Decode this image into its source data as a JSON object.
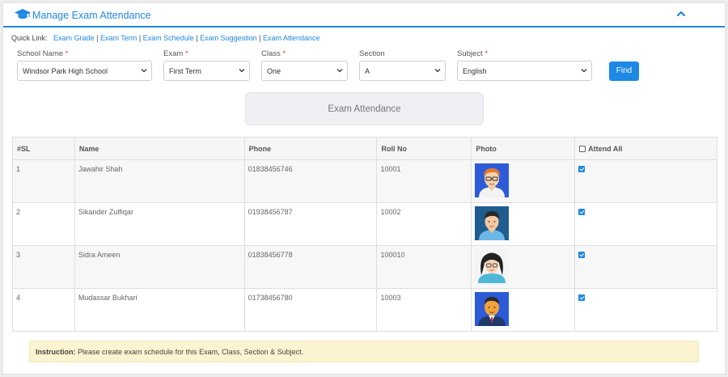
{
  "header": {
    "title": "Manage Exam Attendance"
  },
  "quick_links": {
    "label": "Quick Link:",
    "items": [
      "Exam Grade",
      "Exam Term",
      "Exam Schedule",
      "Exam Suggestion",
      "Exam Attendance"
    ],
    "separator": "|"
  },
  "filters": {
    "school": {
      "label": "School Name",
      "value": "Windsor Park High School",
      "required": "*"
    },
    "exam": {
      "label": "Exam",
      "value": "First Term",
      "required": "*"
    },
    "class": {
      "label": "Class",
      "value": "One",
      "required": "*"
    },
    "section": {
      "label": "Section",
      "value": "A"
    },
    "subject": {
      "label": "Subject",
      "value": "English",
      "required": "*"
    },
    "find_label": "Find"
  },
  "exam_attendance_label": "Exam Attendance",
  "table": {
    "headers": {
      "sl": "#SL",
      "name": "Name",
      "phone": "Phone",
      "roll": "Roll No",
      "photo": "Photo",
      "attend": "Attend All"
    },
    "rows": [
      {
        "sl": "1",
        "name": "Jawahir Shah",
        "phone": "01838456746",
        "roll": "10001"
      },
      {
        "sl": "2",
        "name": "Sikander Zulfiqar",
        "phone": "01938456787",
        "roll": "10002"
      },
      {
        "sl": "3",
        "name": "Sidra Ameen",
        "phone": "01838456778",
        "roll": "100010"
      },
      {
        "sl": "4",
        "name": "Mudassar Bukhari",
        "phone": "01738456780",
        "roll": "10003"
      }
    ]
  },
  "instruction": {
    "label": "Instruction:",
    "text": "Please create exam schedule for this Exam, Class, Section & Subject."
  },
  "colors": {
    "accent": "#1e88e5",
    "required": "#e53935",
    "instruction_bg": "#fcf3d0"
  }
}
